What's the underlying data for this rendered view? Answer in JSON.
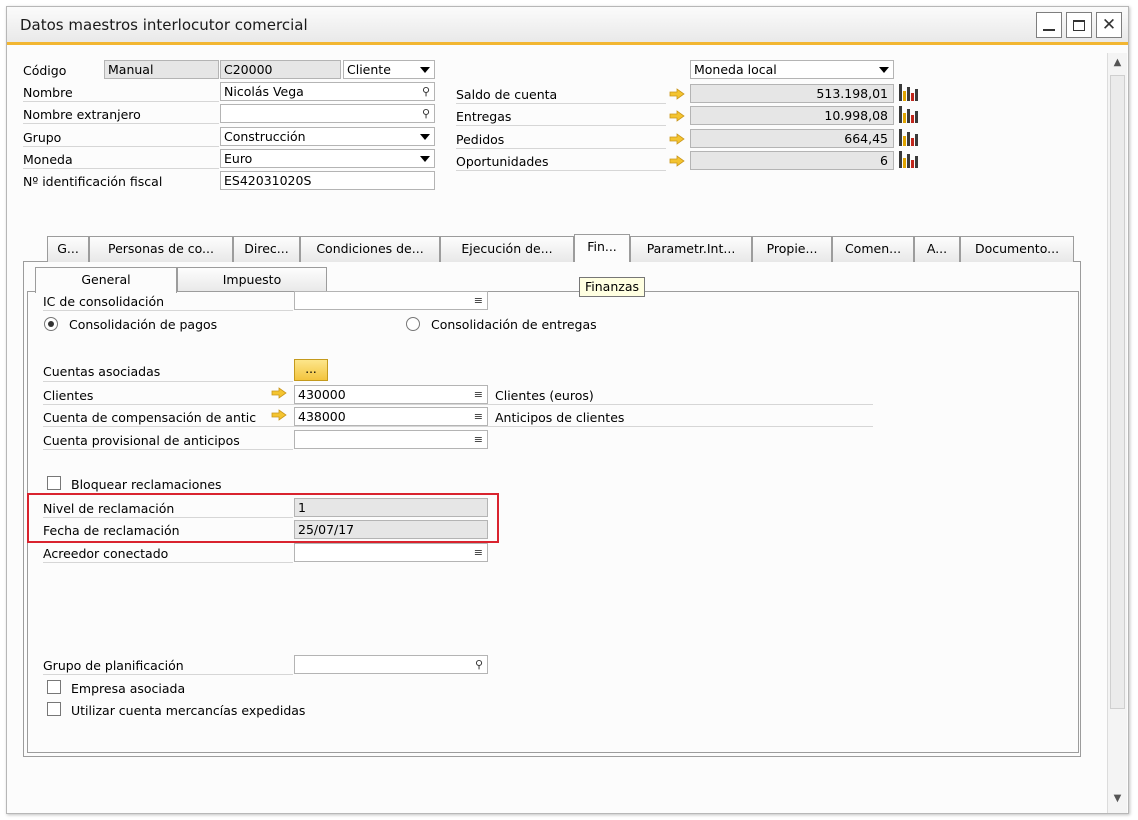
{
  "window": {
    "title": "Datos maestros interlocutor comercial"
  },
  "header": {
    "codigo_label": "Código",
    "codigo_mode": "Manual",
    "codigo_value": "C20000",
    "tipo_value": "Cliente",
    "nombre_label": "Nombre",
    "nombre_value": "Nicolás Vega",
    "nombre_extranjero_label": "Nombre extranjero",
    "nombre_extranjero_value": "",
    "grupo_label": "Grupo",
    "grupo_value": "Construcción",
    "moneda_label": "Moneda",
    "moneda_value": "Euro",
    "nif_label": "Nº identificación fiscal",
    "nif_value": "ES42031020S"
  },
  "balances": {
    "currency_select": "Moneda local",
    "rows": [
      {
        "label": "Saldo de cuenta",
        "value": "513.198,01"
      },
      {
        "label": "Entregas",
        "value": "10.998,08"
      },
      {
        "label": "Pedidos",
        "value": "664,45"
      },
      {
        "label": "Oportunidades",
        "value": "6"
      }
    ]
  },
  "tabs": [
    {
      "label": "G..."
    },
    {
      "label": "Personas de co..."
    },
    {
      "label": "Direc..."
    },
    {
      "label": "Condiciones de..."
    },
    {
      "label": "Ejecución de..."
    },
    {
      "label": "Fin..."
    },
    {
      "label": "Parametr.Int..."
    },
    {
      "label": "Propie..."
    },
    {
      "label": "Comen..."
    },
    {
      "label": "A..."
    },
    {
      "label": "Documento..."
    }
  ],
  "tooltip": "Finanzas",
  "subtabs": [
    {
      "label": "General"
    },
    {
      "label": "Impuesto"
    }
  ],
  "finanzas": {
    "ic_consolidacion_label": "IC de consolidación",
    "ic_consolidacion_value": "",
    "radio_pagos": "Consolidación de pagos",
    "radio_entregas": "Consolidación de entregas",
    "cuentas_asociadas_label": "Cuentas asociadas",
    "cuentas_asociadas_button": "...",
    "clientes_label": "Clientes",
    "clientes_value": "430000",
    "clientes_desc": "Clientes (euros)",
    "compensacion_label": "Cuenta de compensación de antic",
    "compensacion_value": "438000",
    "compensacion_desc": "Anticipos de clientes",
    "provisional_label": "Cuenta provisional de anticipos",
    "provisional_value": "",
    "bloquear_label": "Bloquear reclamaciones",
    "nivel_label": "Nivel de reclamación",
    "nivel_value": "1",
    "fecha_label": "Fecha de reclamación",
    "fecha_value": "25/07/17",
    "acreedor_label": "Acreedor conectado",
    "acreedor_value": "",
    "planificacion_label": "Grupo de planificación",
    "planificacion_value": "",
    "empresa_asociada_label": "Empresa asociada",
    "mercancias_label": "Utilizar cuenta mercancías expedidas"
  },
  "colors": {
    "accent_underline": "#f2b632",
    "highlight_box": "#d9232e",
    "arrow": "#f4c430"
  }
}
